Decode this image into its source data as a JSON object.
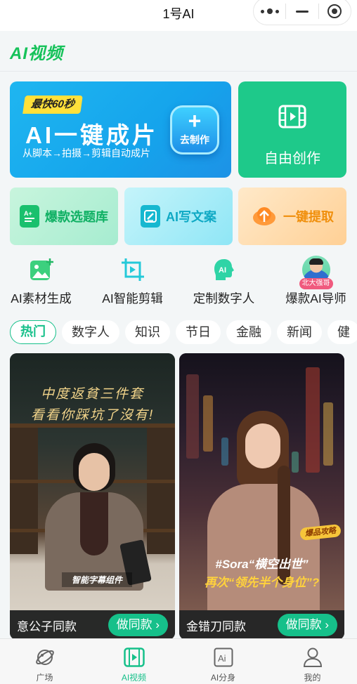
{
  "topbar": {
    "title": "1号AI"
  },
  "header": {
    "brand": "AI视频"
  },
  "hero": {
    "badge": "最快60秒",
    "headline": "AI一键成片",
    "subtitle": "从脚本→拍摄→剪辑自动成片",
    "make_button_label": "去制作"
  },
  "free_create": {
    "label": "自由创作"
  },
  "features": [
    {
      "label": "爆款选题库",
      "icon": "topic-library-icon"
    },
    {
      "label": "AI写文案",
      "icon": "edit-icon"
    },
    {
      "label": "一键提取",
      "icon": "upload-cloud-icon"
    }
  ],
  "tools": [
    {
      "label": "AI素材生成",
      "icon": "image-add-icon"
    },
    {
      "label": "AI智能剪辑",
      "icon": "crop-play-icon"
    },
    {
      "label": "定制数字人",
      "icon": "ai-head-icon"
    },
    {
      "label": "爆款AI导师",
      "icon": "mentor-avatar",
      "tag": "北大强哥"
    }
  ],
  "tabs": [
    "热门",
    "数字人",
    "知识",
    "节日",
    "金融",
    "新闻",
    "健"
  ],
  "active_tab": "热门",
  "videos": [
    {
      "title": "意公子同款",
      "button": "做同款 ›",
      "caption_line1": "中度返貧三件套",
      "caption_line2": "看看你踩坑了沒有!",
      "overlay": "智能字幕组件"
    },
    {
      "title": "金错刀同款",
      "button": "做同款 ›",
      "sticker": "爆品攻略",
      "line1": "#Sora“横空出世”",
      "line2": "再次“领先半个身位”?"
    }
  ],
  "nav": [
    {
      "label": "广场",
      "icon": "planet-icon"
    },
    {
      "label": "AI视频",
      "icon": "film-icon",
      "active": true
    },
    {
      "label": "AI分身",
      "icon": "ai-box-icon"
    },
    {
      "label": "我的",
      "icon": "user-icon"
    }
  ],
  "colors": {
    "brand_green": "#16c25a",
    "accent_teal": "#16c08a",
    "hero_blue": "#1fb6f0"
  }
}
